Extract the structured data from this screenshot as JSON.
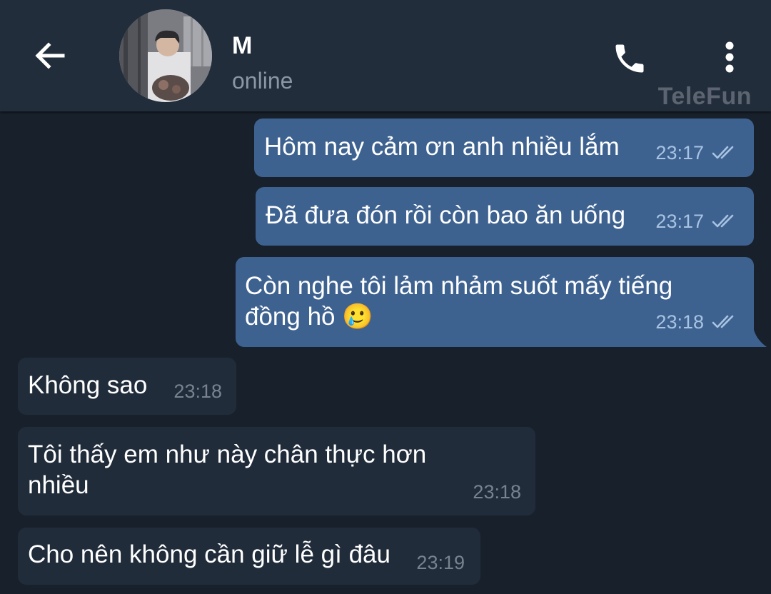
{
  "header": {
    "contact_name": "M",
    "status": "online",
    "watermark": "TeleFun",
    "icons": {
      "back": "arrow-left-icon",
      "call": "phone-icon",
      "menu": "more-vertical-icon",
      "avatar": "contact-avatar-photo"
    }
  },
  "messages": [
    {
      "direction": "outgoing",
      "lines": [
        "Hôm nay cảm ơn anh nhiều lắm"
      ],
      "time": "23:17",
      "status_icon": "double-check-icon"
    },
    {
      "direction": "outgoing",
      "lines": [
        "Đã đưa đón rồi còn bao ăn uống"
      ],
      "time": "23:17",
      "status_icon": "double-check-icon"
    },
    {
      "direction": "outgoing",
      "lines": [
        "Còn nghe tôi lảm nhảm suốt mấy tiếng",
        "đồng hồ 🥲"
      ],
      "time": "23:18",
      "status_icon": "double-check-icon"
    },
    {
      "direction": "incoming",
      "lines": [
        "Không sao"
      ],
      "time": "23:18"
    },
    {
      "direction": "incoming",
      "lines": [
        "Tôi thấy em như này chân thực hơn",
        "nhiều"
      ],
      "time": "23:18"
    },
    {
      "direction": "incoming",
      "lines": [
        "Cho nên không cần giữ lễ gì đâu"
      ],
      "time": "23:19"
    }
  ],
  "colors": {
    "background": "#18202b",
    "header": "#222d3b",
    "outgoing_bubble": "#3e6290",
    "incoming_bubble": "#212c3b",
    "outgoing_meta": "#a9c3e2",
    "incoming_meta": "#78838f"
  }
}
